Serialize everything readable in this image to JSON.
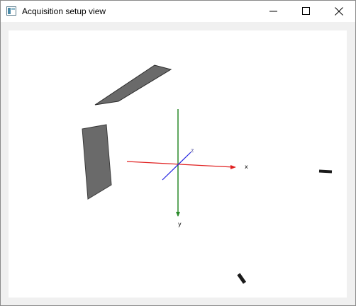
{
  "window": {
    "title": "Acquisition setup view",
    "controls": {
      "minimize": "minimize",
      "maximize": "maximize",
      "close": "close"
    }
  },
  "scene": {
    "axes": {
      "x_label": "x",
      "y_label": "y",
      "z_label": "z",
      "x_color": "#e02020",
      "y_color": "#2a8a2a",
      "z_color": "#2020e0"
    },
    "object_color": "#6a6a6a",
    "marker_color": "#1a1a1a"
  }
}
